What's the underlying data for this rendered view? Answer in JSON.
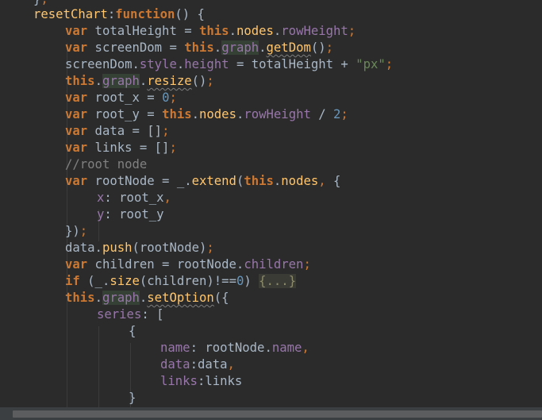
{
  "editor": {
    "lines": [
      [
        {
          "t": "}",
          "c": "plain"
        },
        {
          "t": ";",
          "c": "punc"
        }
      ],
      [
        {
          "t": "resetChart",
          "c": "fn"
        },
        {
          "t": ":",
          "c": "plain"
        },
        {
          "t": "function",
          "c": "kw"
        },
        {
          "t": "() {",
          "c": "plain"
        }
      ],
      [
        {
          "t": "var",
          "c": "kw"
        },
        {
          "t": " totalHeight = ",
          "c": "plain"
        },
        {
          "t": "this",
          "c": "kw"
        },
        {
          "t": ".",
          "c": "plain"
        },
        {
          "t": "nodes",
          "c": "fn"
        },
        {
          "t": ".",
          "c": "plain"
        },
        {
          "t": "rowHeight",
          "c": "prop"
        },
        {
          "t": ";",
          "c": "punc"
        }
      ],
      [
        {
          "t": "var",
          "c": "kw"
        },
        {
          "t": " screenDom = ",
          "c": "plain"
        },
        {
          "t": "this",
          "c": "kw"
        },
        {
          "t": ".",
          "c": "plain"
        },
        {
          "t": "graph",
          "c": "prop",
          "x": "hl"
        },
        {
          "t": ".",
          "c": "plain"
        },
        {
          "t": "getDom",
          "c": "fn",
          "x": "wavy"
        },
        {
          "t": "()",
          "c": "plain"
        },
        {
          "t": ";",
          "c": "punc"
        }
      ],
      [
        {
          "t": "screenDom.",
          "c": "plain"
        },
        {
          "t": "style",
          "c": "prop"
        },
        {
          "t": ".",
          "c": "plain"
        },
        {
          "t": "height",
          "c": "prop"
        },
        {
          "t": " = totalHeight + ",
          "c": "plain"
        },
        {
          "t": "\"px\"",
          "c": "str"
        },
        {
          "t": ";",
          "c": "punc"
        }
      ],
      [
        {
          "t": "this",
          "c": "kw"
        },
        {
          "t": ".",
          "c": "plain"
        },
        {
          "t": "graph",
          "c": "prop",
          "x": "hl"
        },
        {
          "t": ".",
          "c": "plain"
        },
        {
          "t": "resize",
          "c": "fn",
          "x": "wavy"
        },
        {
          "t": "()",
          "c": "plain"
        },
        {
          "t": ";",
          "c": "punc"
        }
      ],
      [
        {
          "t": "var",
          "c": "kw"
        },
        {
          "t": " root_x = ",
          "c": "plain"
        },
        {
          "t": "0",
          "c": "num"
        },
        {
          "t": ";",
          "c": "punc"
        }
      ],
      [
        {
          "t": "var",
          "c": "kw"
        },
        {
          "t": " root_y = ",
          "c": "plain"
        },
        {
          "t": "this",
          "c": "kw"
        },
        {
          "t": ".",
          "c": "plain"
        },
        {
          "t": "nodes",
          "c": "fn"
        },
        {
          "t": ".",
          "c": "plain"
        },
        {
          "t": "rowHeight",
          "c": "prop"
        },
        {
          "t": " / ",
          "c": "plain"
        },
        {
          "t": "2",
          "c": "num"
        },
        {
          "t": ";",
          "c": "punc"
        }
      ],
      [
        {
          "t": "var",
          "c": "kw"
        },
        {
          "t": " data = []",
          "c": "plain"
        },
        {
          "t": ";",
          "c": "punc"
        }
      ],
      [
        {
          "t": "var",
          "c": "kw"
        },
        {
          "t": " links = []",
          "c": "plain"
        },
        {
          "t": ";",
          "c": "punc"
        }
      ],
      [
        {
          "t": "//root node",
          "c": "cmt"
        }
      ],
      [
        {
          "t": "var",
          "c": "kw"
        },
        {
          "t": " rootNode = _.",
          "c": "plain"
        },
        {
          "t": "extend",
          "c": "fn"
        },
        {
          "t": "(",
          "c": "plain"
        },
        {
          "t": "this",
          "c": "kw"
        },
        {
          "t": ".",
          "c": "plain"
        },
        {
          "t": "nodes",
          "c": "fn"
        },
        {
          "t": ", ",
          "c": "punc"
        },
        {
          "t": "{",
          "c": "plain"
        }
      ],
      [
        {
          "t": "x",
          "c": "prop"
        },
        {
          "t": ": root_x",
          "c": "plain"
        },
        {
          "t": ",",
          "c": "punc"
        }
      ],
      [
        {
          "t": "y",
          "c": "prop"
        },
        {
          "t": ": root_y",
          "c": "plain"
        }
      ],
      [
        {
          "t": "})",
          "c": "plain"
        },
        {
          "t": ";",
          "c": "punc"
        }
      ],
      [
        {
          "t": "data.",
          "c": "plain"
        },
        {
          "t": "push",
          "c": "fn"
        },
        {
          "t": "(rootNode)",
          "c": "plain"
        },
        {
          "t": ";",
          "c": "punc"
        }
      ],
      [
        {
          "t": "var",
          "c": "kw"
        },
        {
          "t": " children = rootNode.",
          "c": "plain"
        },
        {
          "t": "children",
          "c": "prop"
        },
        {
          "t": ";",
          "c": "punc"
        }
      ],
      [
        {
          "t": "if",
          "c": "kw"
        },
        {
          "t": " (_.",
          "c": "plain"
        },
        {
          "t": "size",
          "c": "fn"
        },
        {
          "t": "(children)!==",
          "c": "plain"
        },
        {
          "t": "0",
          "c": "num"
        },
        {
          "t": ") ",
          "c": "plain"
        },
        {
          "t": "{...}",
          "c": "plain",
          "x": "fold"
        }
      ],
      [
        {
          "t": "this",
          "c": "kw"
        },
        {
          "t": ".",
          "c": "plain"
        },
        {
          "t": "graph",
          "c": "prop",
          "x": "hl"
        },
        {
          "t": ".",
          "c": "plain"
        },
        {
          "t": "setOption",
          "c": "fn",
          "x": "wavy"
        },
        {
          "t": "({",
          "c": "plain"
        }
      ],
      [
        {
          "t": "series",
          "c": "prop"
        },
        {
          "t": ": [",
          "c": "plain"
        }
      ],
      [
        {
          "t": "{",
          "c": "plain"
        }
      ],
      [
        {
          "t": "name",
          "c": "prop"
        },
        {
          "t": ": rootNode.",
          "c": "plain"
        },
        {
          "t": "name",
          "c": "prop"
        },
        {
          "t": ",",
          "c": "punc"
        }
      ],
      [
        {
          "t": "data",
          "c": "prop"
        },
        {
          "t": ":data",
          "c": "plain"
        },
        {
          "t": ",",
          "c": "punc"
        }
      ],
      [
        {
          "t": "links",
          "c": "prop"
        },
        {
          "t": ":links",
          "c": "plain"
        }
      ],
      [
        {
          "t": "}",
          "c": "plain"
        }
      ],
      [
        {
          "t": "]",
          "c": "plain"
        }
      ]
    ]
  }
}
